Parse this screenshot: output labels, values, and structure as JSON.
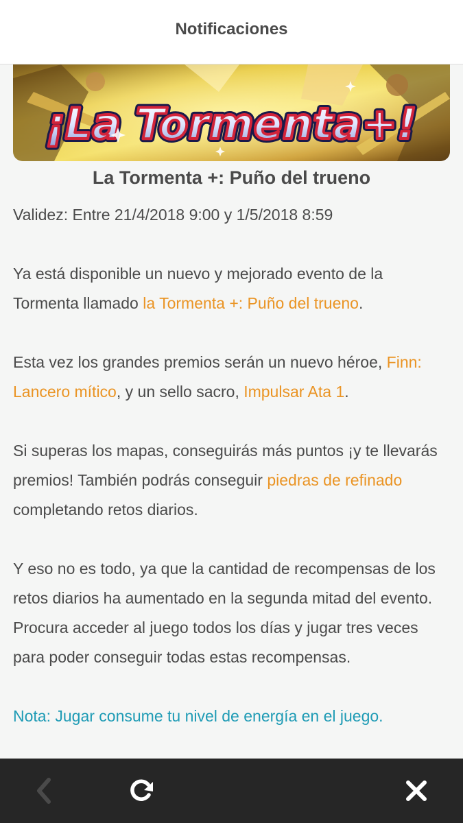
{
  "header": {
    "title": "Notificaciones"
  },
  "banner": {
    "title": "¡La Tormenta+!"
  },
  "article": {
    "title": "La Tormenta +: Puño del trueno",
    "validity": "Validez: Entre 21/4/2018 9:00 y 1/5/2018 8:59",
    "p1": {
      "text_a": "Ya está disponible un nuevo y mejorado evento de la Tormenta llamado ",
      "link": "la Tormenta +: Puño del trueno",
      "text_b": "."
    },
    "p2": {
      "text_a": "Esta vez los grandes premios serán un nuevo héroe, ",
      "link1": "Finn: Lancero mítico",
      "text_b": ", y un sello sacro, ",
      "link2": "Impulsar Ata 1",
      "text_c": "."
    },
    "p3": {
      "text_a": "Si superas los mapas, conseguirás más puntos ¡y te llevarás premios! También podrás conseguir ",
      "link": "piedras de refinado",
      "text_b": " completando retos diarios."
    },
    "p4": "Y eso no es todo, ya que la cantidad de recompensas de los retos diarios ha aumentado en la segunda mitad del evento. Procura acceder al juego todos los días y jugar tres veces para poder conseguir todas estas recompensas.",
    "note": "Nota: Jugar consume tu nivel de energía en el juego."
  },
  "bottombar": {
    "back_icon": "chevron-left-icon",
    "refresh_icon": "refresh-icon",
    "close_icon": "close-icon"
  },
  "colors": {
    "highlight": "#ea9424",
    "note": "#1e9bb5",
    "text": "#4a4a4a",
    "bar": "#262626"
  }
}
